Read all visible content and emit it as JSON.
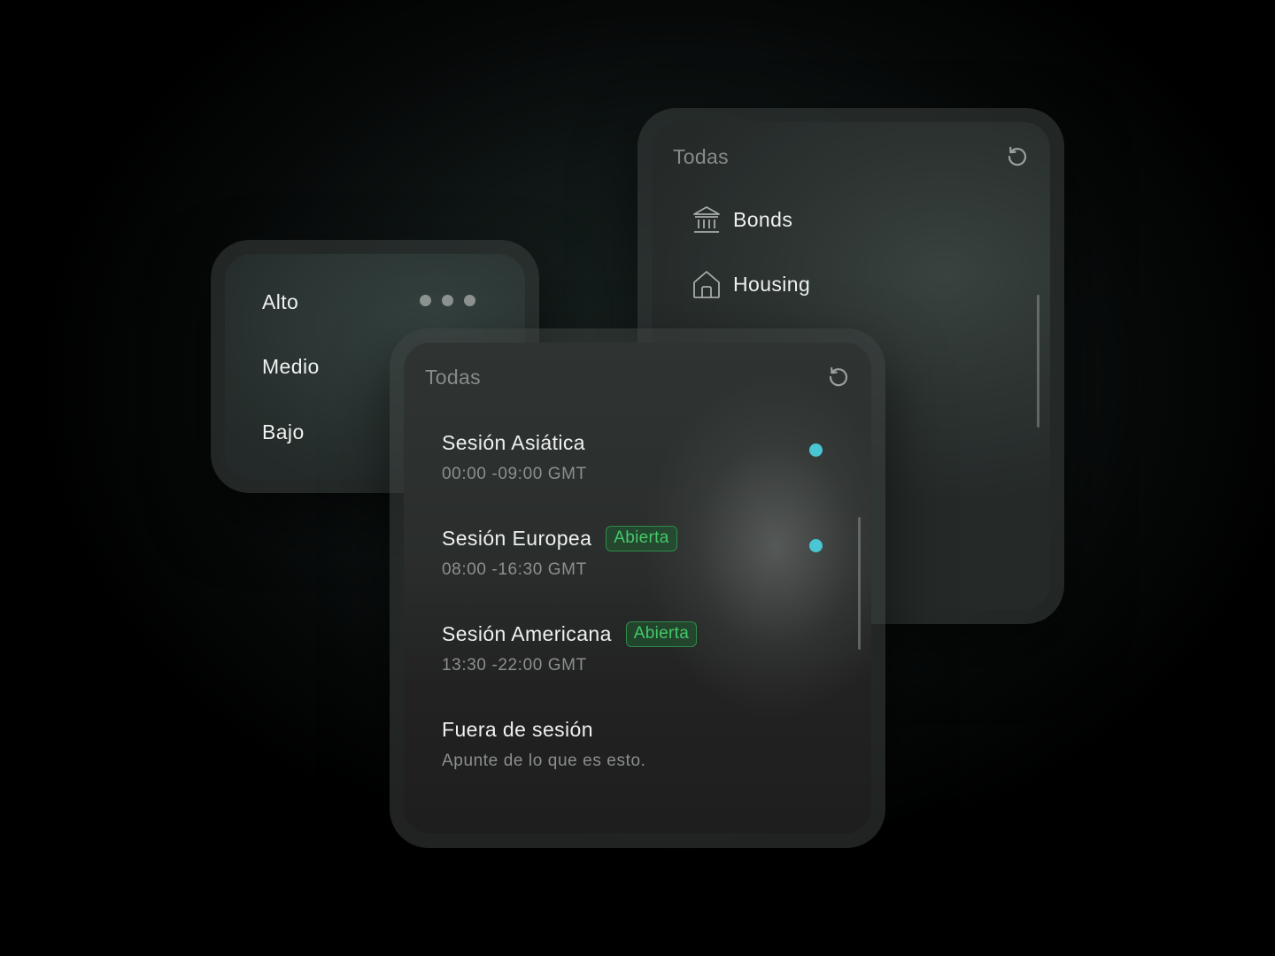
{
  "categories_panel": {
    "filter_label": "Todas",
    "refresh_icon": "refresh-icon",
    "items": [
      {
        "label": "Bonds",
        "icon": "bank-icon"
      },
      {
        "label": "Housing",
        "icon": "house-icon"
      }
    ]
  },
  "impact_panel": {
    "items": [
      {
        "label": "Alto"
      },
      {
        "label": "Medio"
      },
      {
        "label": "Bajo"
      }
    ],
    "more_icon": "more-dots-icon"
  },
  "sessions_panel": {
    "filter_label": "Todas",
    "refresh_icon": "refresh-icon",
    "sessions": [
      {
        "name": "Sesión Asiática",
        "hours": "00:00 -09:00 GMT",
        "badge": "",
        "selected": true
      },
      {
        "name": "Sesión Europea",
        "hours": "08:00 -16:30 GMT",
        "badge": "Abierta",
        "selected": true
      },
      {
        "name": "Sesión Americana",
        "hours": "13:30 -22:00 GMT",
        "badge": "Abierta",
        "selected": false
      },
      {
        "name": "Fuera de sesión",
        "hours": "Apunte de lo que es esto.",
        "badge": "",
        "selected": false
      }
    ]
  },
  "colors": {
    "badge_text": "#45c86a",
    "badge_border": "#2f8a48",
    "selected_dot": "#49c6d3",
    "muted_text": "#8a908d"
  }
}
